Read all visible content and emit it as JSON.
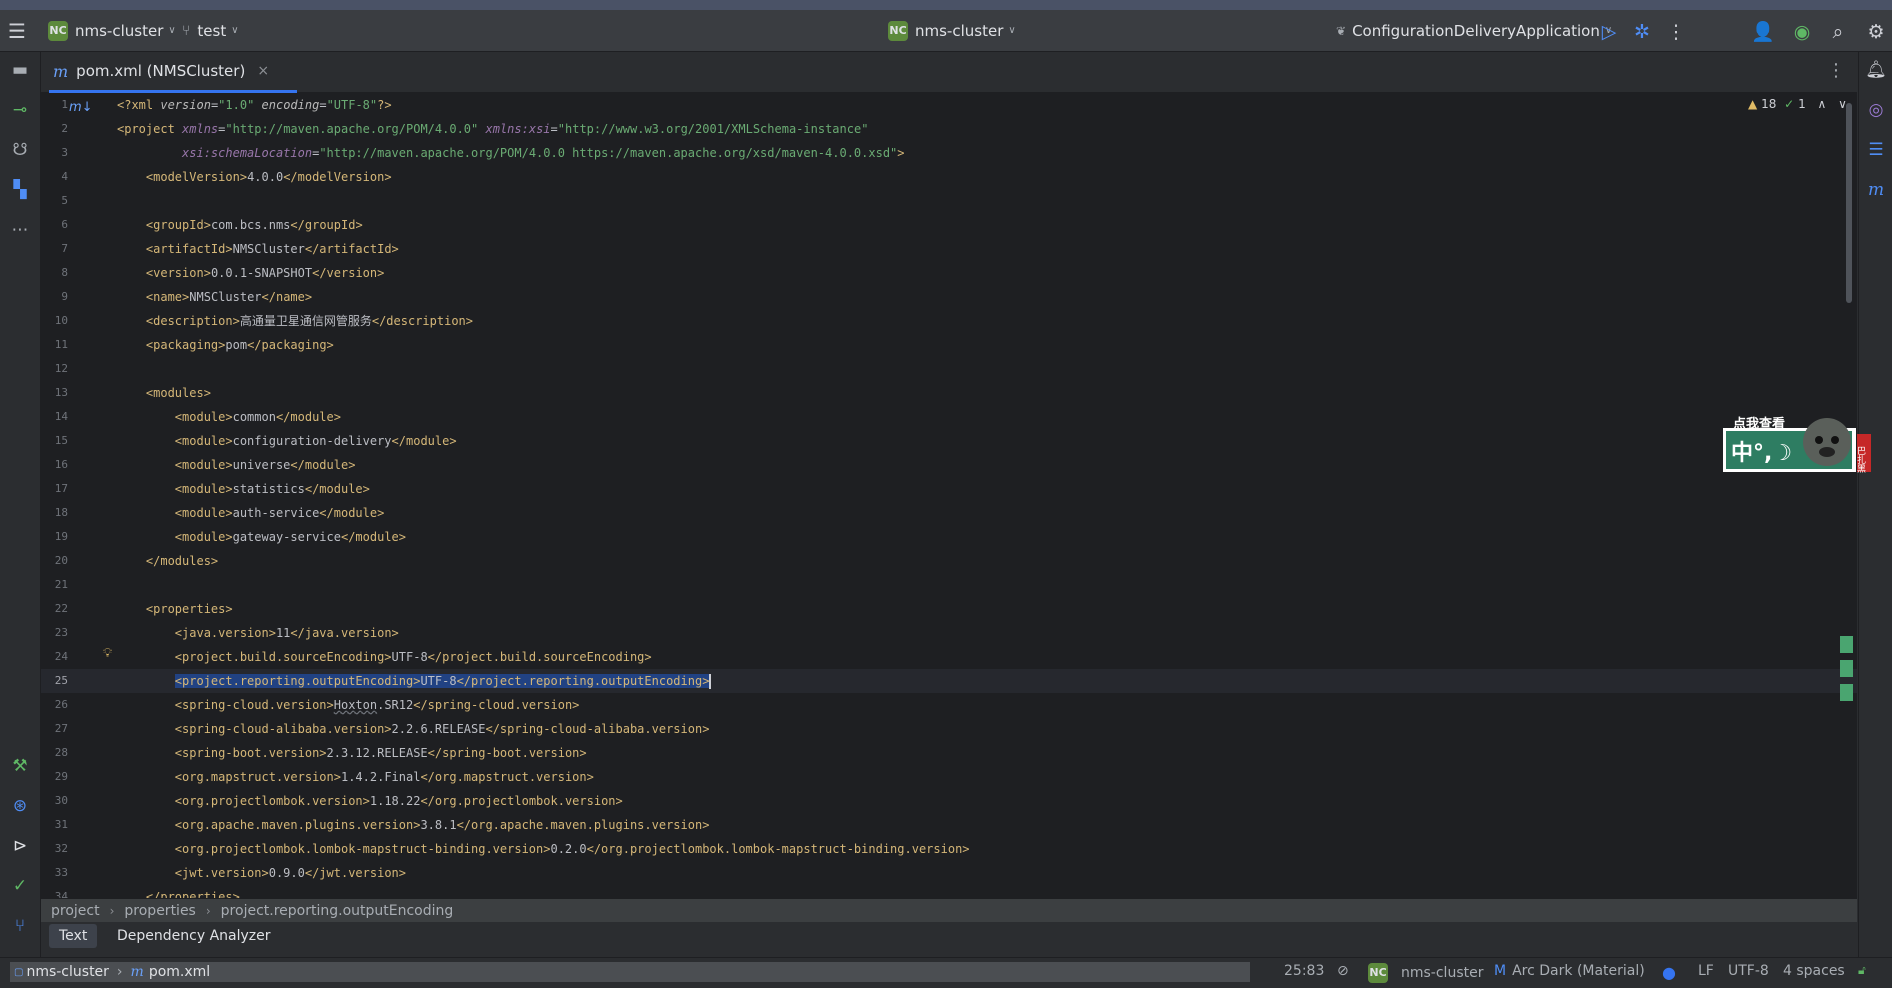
{
  "titlebar": {
    "project": "nms-cluster",
    "branch": "test",
    "center_project": "nms-cluster",
    "project_badge": "NC",
    "run_config": "ConfigurationDeliveryApplication"
  },
  "tab": {
    "icon": "m",
    "label": "pom.xml (NMSCluster)",
    "close": "×"
  },
  "inspections": {
    "warnings": "18",
    "ok": "1"
  },
  "editor": {
    "current_line": 25,
    "lines": [
      {
        "n": "1",
        "indent": "",
        "html_parts": [
          [
            "decl",
            "<?xml "
          ],
          [
            "attr",
            "version"
          ],
          [
            "txt",
            "="
          ],
          [
            "str",
            "\"1.0\""
          ],
          [
            "txt",
            " "
          ],
          [
            "attr",
            "encoding"
          ],
          [
            "txt",
            "="
          ],
          [
            "str",
            "\"UTF-8\""
          ],
          [
            "decl",
            "?>"
          ]
        ]
      },
      {
        "n": "2",
        "indent": "",
        "html_parts": [
          [
            "tag",
            "<project "
          ],
          [
            "ns",
            "xmlns"
          ],
          [
            "txt",
            "="
          ],
          [
            "str",
            "\"http://maven.apache.org/POM/4.0.0\""
          ],
          [
            "txt",
            " "
          ],
          [
            "ns",
            "xmlns:xsi"
          ],
          [
            "txt",
            "="
          ],
          [
            "str",
            "\"http://www.w3.org/2001/XMLSchema-instance\""
          ]
        ]
      },
      {
        "n": "3",
        "indent": "         ",
        "html_parts": [
          [
            "ns",
            "xsi:schemaLocation"
          ],
          [
            "txt",
            "="
          ],
          [
            "str",
            "\"http://maven.apache.org/POM/4.0.0 https://maven.apache.org/xsd/maven-4.0.0.xsd\""
          ],
          [
            "tag",
            ">"
          ]
        ]
      },
      {
        "n": "4",
        "indent": "    ",
        "html_parts": [
          [
            "tag",
            "<modelVersion>"
          ],
          [
            "txt",
            "4.0.0"
          ],
          [
            "tag",
            "</modelVersion>"
          ]
        ]
      },
      {
        "n": "5",
        "indent": "",
        "html_parts": []
      },
      {
        "n": "6",
        "indent": "    ",
        "html_parts": [
          [
            "tag",
            "<groupId>"
          ],
          [
            "txt",
            "com.bcs.nms"
          ],
          [
            "tag",
            "</groupId>"
          ]
        ]
      },
      {
        "n": "7",
        "indent": "    ",
        "html_parts": [
          [
            "tag",
            "<artifactId>"
          ],
          [
            "txt",
            "NMSCluster"
          ],
          [
            "tag",
            "</artifactId>"
          ]
        ]
      },
      {
        "n": "8",
        "indent": "    ",
        "html_parts": [
          [
            "tag",
            "<version>"
          ],
          [
            "txt",
            "0.0.1-SNAPSHOT"
          ],
          [
            "tag",
            "</version>"
          ]
        ]
      },
      {
        "n": "9",
        "indent": "    ",
        "html_parts": [
          [
            "tag",
            "<name>"
          ],
          [
            "txt",
            "NMSCluster"
          ],
          [
            "tag",
            "</name>"
          ]
        ]
      },
      {
        "n": "10",
        "indent": "    ",
        "html_parts": [
          [
            "tag",
            "<description>"
          ],
          [
            "txt",
            "高通量卫星通信网管服务"
          ],
          [
            "tag",
            "</description>"
          ]
        ]
      },
      {
        "n": "11",
        "indent": "    ",
        "html_parts": [
          [
            "tag",
            "<packaging>"
          ],
          [
            "txt",
            "pom"
          ],
          [
            "tag",
            "</packaging>"
          ]
        ]
      },
      {
        "n": "12",
        "indent": "",
        "html_parts": []
      },
      {
        "n": "13",
        "indent": "    ",
        "html_parts": [
          [
            "tag",
            "<modules>"
          ]
        ]
      },
      {
        "n": "14",
        "indent": "        ",
        "html_parts": [
          [
            "tag",
            "<module>"
          ],
          [
            "txt",
            "common"
          ],
          [
            "tag",
            "</module>"
          ]
        ]
      },
      {
        "n": "15",
        "indent": "        ",
        "html_parts": [
          [
            "tag",
            "<module>"
          ],
          [
            "txt",
            "configuration-delivery"
          ],
          [
            "tag",
            "</module>"
          ]
        ]
      },
      {
        "n": "16",
        "indent": "        ",
        "html_parts": [
          [
            "tag",
            "<module>"
          ],
          [
            "txt",
            "universe"
          ],
          [
            "tag",
            "</module>"
          ]
        ]
      },
      {
        "n": "17",
        "indent": "        ",
        "html_parts": [
          [
            "tag",
            "<module>"
          ],
          [
            "txt",
            "statistics"
          ],
          [
            "tag",
            "</module>"
          ]
        ]
      },
      {
        "n": "18",
        "indent": "        ",
        "html_parts": [
          [
            "tag",
            "<module>"
          ],
          [
            "txt",
            "auth-service"
          ],
          [
            "tag",
            "</module>"
          ]
        ]
      },
      {
        "n": "19",
        "indent": "        ",
        "html_parts": [
          [
            "tag",
            "<module>"
          ],
          [
            "txt",
            "gateway-service"
          ],
          [
            "tag",
            "</module>"
          ]
        ]
      },
      {
        "n": "20",
        "indent": "    ",
        "html_parts": [
          [
            "tag",
            "</modules>"
          ]
        ]
      },
      {
        "n": "21",
        "indent": "",
        "html_parts": []
      },
      {
        "n": "22",
        "indent": "    ",
        "html_parts": [
          [
            "tag",
            "<properties>"
          ]
        ]
      },
      {
        "n": "23",
        "indent": "        ",
        "html_parts": [
          [
            "tag",
            "<java.version>"
          ],
          [
            "txt",
            "11"
          ],
          [
            "tag",
            "</java.version>"
          ]
        ]
      },
      {
        "n": "24",
        "indent": "        ",
        "html_parts": [
          [
            "tag",
            "<project.build.sourceEncoding>"
          ],
          [
            "txt",
            "UTF-8"
          ],
          [
            "tag",
            "</project.build.sourceEncoding>"
          ]
        ]
      },
      {
        "n": "25",
        "indent": "        ",
        "html_parts": [
          [
            "tag sel",
            "<project.reporting.outputEncoding>"
          ],
          [
            "txt sel",
            "UTF-8"
          ],
          [
            "tag sel",
            "</project.reporting.outputEncoding>"
          ]
        ]
      },
      {
        "n": "26",
        "indent": "        ",
        "html_parts": [
          [
            "tag",
            "<spring-cloud.version>"
          ],
          [
            "txt under",
            "Hoxton"
          ],
          [
            "txt",
            ".SR12"
          ],
          [
            "tag",
            "</spring-cloud.version>"
          ]
        ]
      },
      {
        "n": "27",
        "indent": "        ",
        "html_parts": [
          [
            "tag",
            "<spring-cloud-alibaba.version>"
          ],
          [
            "txt",
            "2.2.6.RELEASE"
          ],
          [
            "tag",
            "</spring-cloud-alibaba.version>"
          ]
        ]
      },
      {
        "n": "28",
        "indent": "        ",
        "html_parts": [
          [
            "tag",
            "<spring-boot.version>"
          ],
          [
            "txt",
            "2.3.12.RELEASE"
          ],
          [
            "tag",
            "</spring-boot.version>"
          ]
        ]
      },
      {
        "n": "29",
        "indent": "        ",
        "html_parts": [
          [
            "tag",
            "<org.mapstruct.version>"
          ],
          [
            "txt",
            "1.4.2.Final"
          ],
          [
            "tag",
            "</org.mapstruct.version>"
          ]
        ]
      },
      {
        "n": "30",
        "indent": "        ",
        "html_parts": [
          [
            "tag",
            "<org.projectlombok.version>"
          ],
          [
            "txt",
            "1.18.22"
          ],
          [
            "tag",
            "</org.projectlombok.version>"
          ]
        ]
      },
      {
        "n": "31",
        "indent": "        ",
        "html_parts": [
          [
            "tag",
            "<org.apache.maven.plugins.version>"
          ],
          [
            "txt",
            "3.8.1"
          ],
          [
            "tag",
            "</org.apache.maven.plugins.version>"
          ]
        ]
      },
      {
        "n": "32",
        "indent": "        ",
        "html_parts": [
          [
            "tag",
            "<org.projectlombok.lombok-mapstruct-binding.version>"
          ],
          [
            "txt",
            "0.2.0"
          ],
          [
            "tag",
            "</org.projectlombok.lombok-mapstruct-binding.version>"
          ]
        ]
      },
      {
        "n": "33",
        "indent": "        ",
        "html_parts": [
          [
            "tag",
            "<jwt.version>"
          ],
          [
            "txt",
            "0.9.0"
          ],
          [
            "tag",
            "</jwt.version>"
          ]
        ]
      },
      {
        "n": "34",
        "indent": "    ",
        "html_parts": [
          [
            "tag",
            "</properties>"
          ]
        ]
      }
    ]
  },
  "breadcrumb": [
    "project",
    "properties",
    "project.reporting.outputEncoding"
  ],
  "bottom_tabs": [
    "Text",
    "Dependency Analyzer"
  ],
  "mascot": {
    "caption": "点我查看",
    "text": "中°,☽",
    "side": "巴扎黑"
  },
  "statusbar": {
    "project": "nms-cluster",
    "file": "pom.xml",
    "position": "25:83",
    "project_badge": "NC",
    "project_name": "nms-cluster",
    "theme": "Arc Dark (Material)",
    "line_sep": "LF",
    "encoding": "UTF-8",
    "indent": "4 spaces"
  },
  "colors": {
    "tag": "#d5b778",
    "string": "#6aab73",
    "accent": "#3574f0",
    "selection": "#214283"
  }
}
